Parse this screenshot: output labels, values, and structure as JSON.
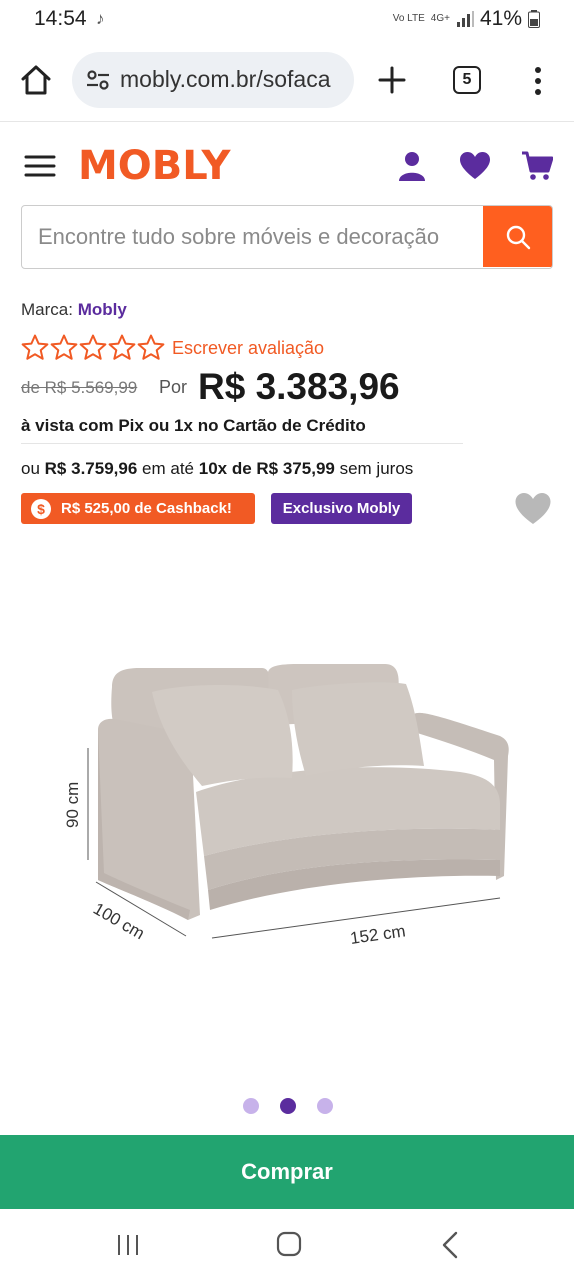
{
  "status_bar": {
    "time": "14:54",
    "network": "4G+",
    "volte": "Vo LTE",
    "battery": "41%"
  },
  "browser": {
    "url": "mobly.com.br/sofaca",
    "tab_count": "5"
  },
  "site": {
    "logo": "MOBLY",
    "search_placeholder": "Encontre tudo sobre móveis e decoração"
  },
  "product": {
    "brand_label": "Marca:",
    "brand_name": "Mobly",
    "rating_stars": 0,
    "review_link": "Escrever avaliação",
    "old_price": "de R$ 5.569,99",
    "por_label": "Por",
    "price": "R$ 3.383,96",
    "payment_note": "à vista com Pix ou 1x no Cartão de Crédito",
    "installment_prefix": "ou",
    "installment_total": "R$ 3.759,96",
    "installment_mid": "em até",
    "installment_count": "10x de R$ 375,99",
    "installment_suffix": "sem juros",
    "cashback_badge": "R$ 525,00 de Cashback!",
    "cashback_coin": "$",
    "exclusive_badge": "Exclusivo Mobly"
  },
  "gallery": {
    "dim_height": "90 cm",
    "dim_depth": "100 cm",
    "dim_width": "152 cm",
    "slide_count": 3,
    "active_slide": 2
  },
  "buy_button": "Comprar",
  "colors": {
    "orange": "#f15a24",
    "purple": "#5b2c9e",
    "green": "#22a470"
  }
}
